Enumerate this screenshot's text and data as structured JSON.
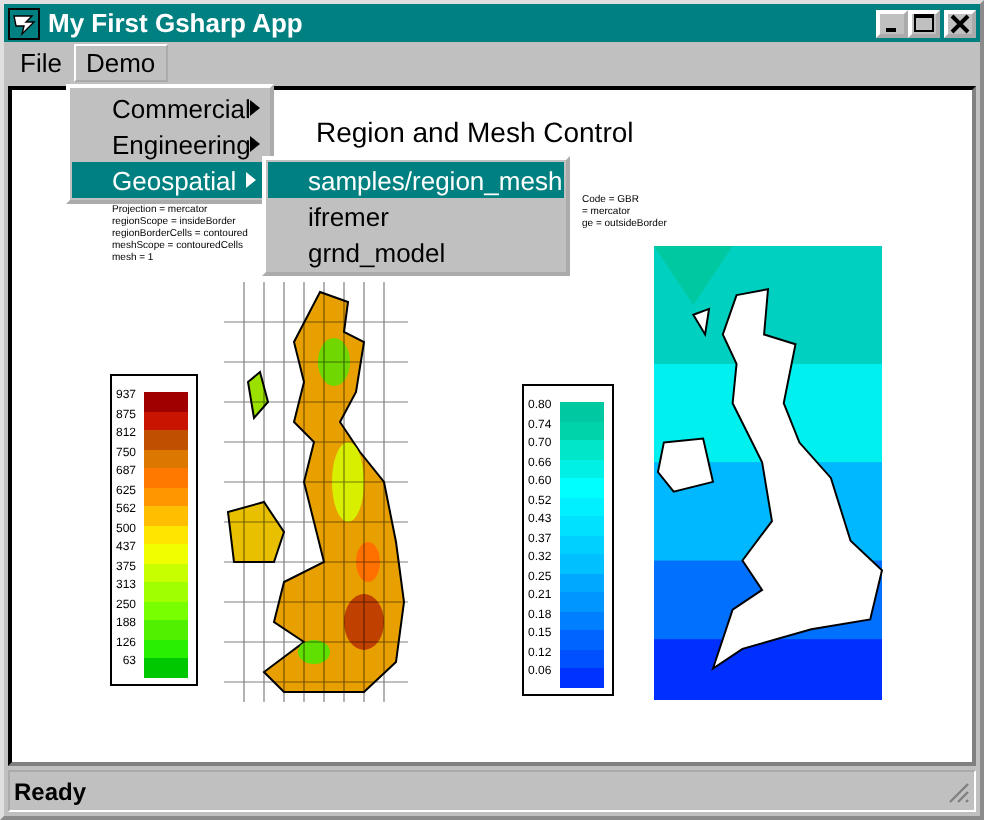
{
  "window": {
    "title": "My First Gsharp App"
  },
  "menu_bar": [
    {
      "label": "File",
      "selected": false
    },
    {
      "label": "Demo",
      "selected": true
    }
  ],
  "demo_menu": [
    {
      "label": "Commercial",
      "selected": false
    },
    {
      "label": "Engineering",
      "selected": false
    },
    {
      "label": "Geospatial",
      "selected": true
    }
  ],
  "geospatial_submenu": [
    {
      "label": "samples/region_mesh",
      "selected": true
    },
    {
      "label": "ifremer",
      "selected": false
    },
    {
      "label": "grnd_model",
      "selected": false
    }
  ],
  "plot": {
    "title": "Region and Mesh Control",
    "left_notes": [
      "Projection = mercator",
      "regionScope = insideBorder",
      "regionBorderCells = contoured",
      "meshScope = contouredCells",
      "mesh = 1"
    ],
    "right_notes": [
      "Code = GBR",
      "= mercator",
      "ge = outsideBorder"
    ],
    "left_legend": [
      {
        "label": "937",
        "color": "#a00000"
      },
      {
        "label": "875",
        "color": "#c81400"
      },
      {
        "label": "812",
        "color": "#c05000"
      },
      {
        "label": "750",
        "color": "#dc7800"
      },
      {
        "label": "687",
        "color": "#ff7800"
      },
      {
        "label": "625",
        "color": "#ff9600"
      },
      {
        "label": "562",
        "color": "#ffbe00"
      },
      {
        "label": "500",
        "color": "#ffe600"
      },
      {
        "label": "437",
        "color": "#f0ff00"
      },
      {
        "label": "375",
        "color": "#c8ff00"
      },
      {
        "label": "313",
        "color": "#a0ff00"
      },
      {
        "label": "250",
        "color": "#78ff00"
      },
      {
        "label": "188",
        "color": "#50f000"
      },
      {
        "label": "126",
        "color": "#28f000"
      },
      {
        "label": "63",
        "color": "#00c800"
      }
    ],
    "right_legend": [
      {
        "label": "0.80",
        "color": "#00c8a0"
      },
      {
        "label": "0.74",
        "color": "#00d2aa"
      },
      {
        "label": "0.70",
        "color": "#00e6c8"
      },
      {
        "label": "0.66",
        "color": "#00f0e6"
      },
      {
        "label": "0.60",
        "color": "#00ffff"
      },
      {
        "label": "0.52",
        "color": "#00f0ff"
      },
      {
        "label": "0.43",
        "color": "#00e0ff"
      },
      {
        "label": "0.37",
        "color": "#00d0ff"
      },
      {
        "label": "0.32",
        "color": "#00c0ff"
      },
      {
        "label": "0.25",
        "color": "#00a8ff"
      },
      {
        "label": "0.21",
        "color": "#0096ff"
      },
      {
        "label": "0.18",
        "color": "#0080ff"
      },
      {
        "label": "0.15",
        "color": "#0064ff"
      },
      {
        "label": "0.12",
        "color": "#0050ff"
      },
      {
        "label": "0.06",
        "color": "#0032ff"
      }
    ]
  },
  "status_bar": {
    "text": "Ready"
  }
}
